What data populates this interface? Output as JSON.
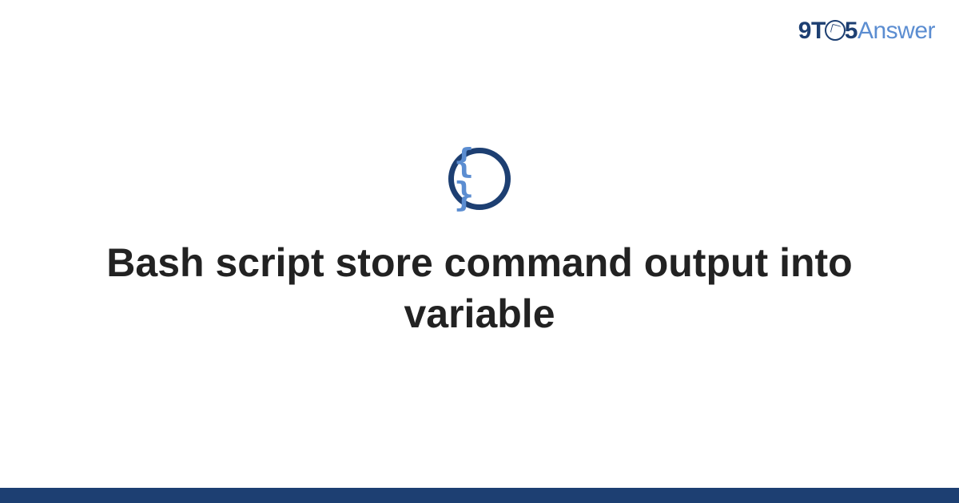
{
  "brand": {
    "nine": "9",
    "t": "T",
    "five": "5",
    "answer": "Answer"
  },
  "icon": {
    "braces": "{ }"
  },
  "title": "Bash script store command output into variable",
  "colors": {
    "primary": "#1d3f72",
    "accent": "#5b8dd1"
  }
}
